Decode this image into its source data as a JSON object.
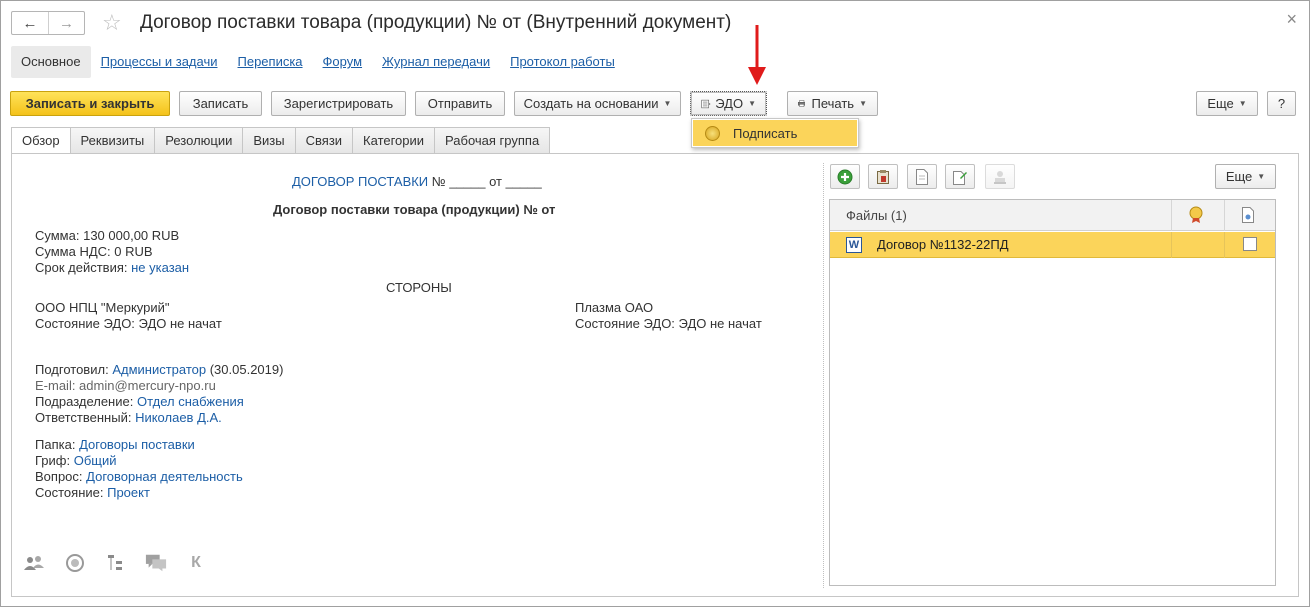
{
  "window": {
    "title": "Договор поставки товара (продукции) № от (Внутренний документ)"
  },
  "nav": {
    "back_icon": "←",
    "forward_icon": "→",
    "star_icon": "☆",
    "close_icon": "×"
  },
  "section_tabs": [
    {
      "label": "Основное"
    },
    {
      "label": "Процессы и задачи"
    },
    {
      "label": "Переписка"
    },
    {
      "label": "Форум"
    },
    {
      "label": "Журнал передачи"
    },
    {
      "label": "Протокол работы"
    }
  ],
  "toolbar": {
    "save_close": "Записать и закрыть",
    "save": "Записать",
    "register": "Зарегистрировать",
    "send": "Отправить",
    "create_based": "Создать на основании",
    "edo": "ЭДО",
    "print": "Печать",
    "more": "Еще",
    "help": "?"
  },
  "edo_menu": {
    "sign": "Подписать"
  },
  "content_tabs": [
    {
      "label": "Обзор"
    },
    {
      "label": "Реквизиты"
    },
    {
      "label": "Резолюции"
    },
    {
      "label": "Визы"
    },
    {
      "label": "Связи"
    },
    {
      "label": "Категории"
    },
    {
      "label": "Рабочая группа"
    }
  ],
  "document": {
    "header_link": "ДОГОВОР ПОСТАВКИ",
    "header_rest": " № _____ от _____",
    "heading": "Договор поставки товара (продукции) № от",
    "sum_label": "Сумма:",
    "sum_value": "130 000,00 RUB",
    "vat_label": "Сумма НДС:",
    "vat_value": "0 RUB",
    "term_label": "Срок действия:",
    "term_value": "не указан",
    "parties": "СТОРОНЫ",
    "party1": "ООО НПЦ \"Меркурий\"",
    "party1_state": "Состояние ЭДО: ЭДО не начат",
    "party2": "Плазма ОАО",
    "party2_state": "Состояние ЭДО: ЭДО не начат",
    "prepared_label": "Подготовил:",
    "prepared_value": "Администратор",
    "prepared_date": " (30.05.2019)",
    "email": "E-mail: admin@mercury-npo.ru",
    "dept_label": "Подразделение:",
    "dept_value": "Отдел снабжения",
    "resp_label": "Ответственный:",
    "resp_value": "Николаев Д.А.",
    "folder_label": "Папка:",
    "folder_value": "Договоры поставки",
    "grif_label": "Гриф:",
    "grif_value": "Общий",
    "question_label": "Вопрос:",
    "question_value": "Договорная деятельность",
    "status_label": "Состояние:",
    "status_value": "Проект"
  },
  "files_panel": {
    "more": "Еще",
    "header": "Файлы (1)",
    "file_name": "Договор №1132-22ПД",
    "word_letter": "W"
  },
  "bottom": {
    "k_letter": "К"
  },
  "colors": {
    "accent_yellow": "#fbd45a",
    "link_blue": "#1c5ea6",
    "arrow_red": "#e01b1b"
  }
}
